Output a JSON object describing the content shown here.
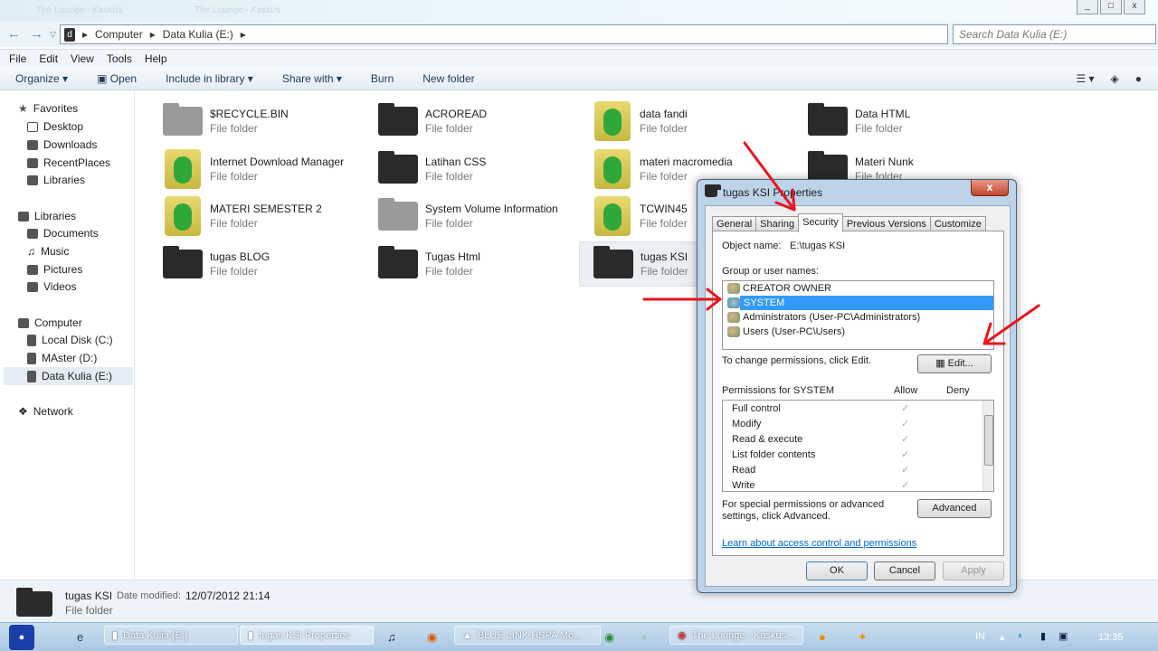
{
  "window": {
    "ghost_tabs": [
      "The Lounge - Kaskus",
      "The Lounge - Kaskus"
    ],
    "controls": [
      "_",
      "□",
      "x"
    ]
  },
  "address": {
    "crumbs": [
      "Computer",
      "Data Kulia (E:)"
    ],
    "search_placeholder": "Search Data Kulia (E:)"
  },
  "menu": [
    "File",
    "Edit",
    "View",
    "Tools",
    "Help"
  ],
  "toolbar": [
    "Organize ▾",
    "Open",
    "Include in library ▾",
    "Share with ▾",
    "Burn",
    "New folder"
  ],
  "nav": {
    "favorites": "Favorites",
    "fav_items": [
      "Desktop",
      "Downloads",
      "RecentPlaces",
      "Libraries"
    ],
    "libraries": "Libraries",
    "lib_items": [
      "Documents",
      "Music",
      "Pictures",
      "Videos"
    ],
    "computer": "Computer",
    "comp_items": [
      "Local Disk (C:)",
      "MAster (D:)",
      "Data Kulia (E:)"
    ],
    "network": "Network"
  },
  "files": [
    {
      "name": "$RECYCLE.BIN",
      "type": "File folder",
      "icon": "gray"
    },
    {
      "name": "ACROREAD",
      "type": "File folder",
      "icon": "black"
    },
    {
      "name": "data fandi",
      "type": "File folder",
      "icon": "frog"
    },
    {
      "name": "Data HTML",
      "type": "File folder",
      "icon": "black"
    },
    {
      "name": "Internet Download Manager",
      "type": "File folder",
      "icon": "frog"
    },
    {
      "name": "Latihan CSS",
      "type": "File folder",
      "icon": "black"
    },
    {
      "name": "materi macromedia",
      "type": "File folder",
      "icon": "frog"
    },
    {
      "name": "Materi Nunk",
      "type": "File folder",
      "icon": "black"
    },
    {
      "name": "MATERI SEMESTER 2",
      "type": "File folder",
      "icon": "frog"
    },
    {
      "name": "System Volume Information",
      "type": "File folder",
      "icon": "gray"
    },
    {
      "name": "TCWIN45",
      "type": "File folder",
      "icon": "frog"
    },
    {
      "name": "",
      "type": "",
      "icon": "none"
    },
    {
      "name": "tugas BLOG",
      "type": "File folder",
      "icon": "black"
    },
    {
      "name": "Tugas Html",
      "type": "File folder",
      "icon": "black"
    },
    {
      "name": "tugas KSI",
      "type": "File folder",
      "icon": "black",
      "selected": true
    }
  ],
  "details": {
    "name": "tugas KSI",
    "modified_label": "Date modified:",
    "modified": "12/07/2012 21:14",
    "type": "File folder"
  },
  "dialog": {
    "title": "tugas KSI Properties",
    "tabs": [
      "General",
      "Sharing",
      "Security",
      "Previous Versions",
      "Customize"
    ],
    "active_tab": "Security",
    "object_label": "Object name:",
    "object_value": "E:\\tugas KSI",
    "group_label": "Group or user names:",
    "users": [
      "CREATOR OWNER",
      "SYSTEM",
      "Administrators (User-PC\\Administrators)",
      "Users (User-PC\\Users)"
    ],
    "change_text": "To change permissions, click Edit.",
    "edit": "Edit...",
    "perm_for": "Permissions for SYSTEM",
    "allow": "Allow",
    "deny": "Deny",
    "perms": [
      "Full control",
      "Modify",
      "Read & execute",
      "List folder contents",
      "Read",
      "Write"
    ],
    "check": "✓",
    "special_text": "For special permissions or advanced settings, click Advanced.",
    "advanced": "Advanced",
    "link": "Learn about access control and permissions",
    "ok": "OK",
    "cancel": "Cancel",
    "apply": "Apply"
  },
  "taskbar": {
    "tasks": [
      "Data Kulia (E:)",
      "tugas KSI Properties",
      "BLUE LINK HSPA Mo...",
      "The Lounge - Kaskus..."
    ],
    "lang": "IN",
    "time": "13:35"
  },
  "annotation_color": "#e8141c"
}
